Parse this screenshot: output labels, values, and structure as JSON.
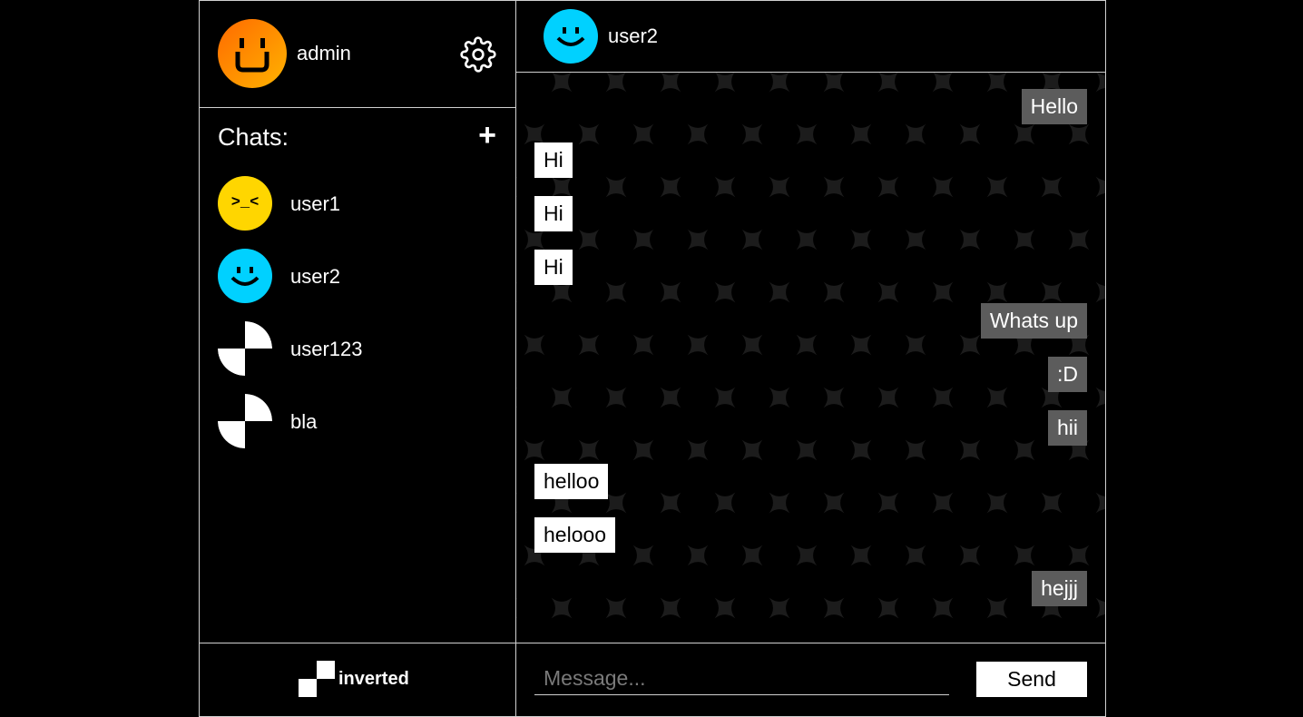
{
  "current_user": {
    "name": "admin",
    "avatar": "grin-face-icon"
  },
  "sidebar": {
    "chats_title": "Chats:",
    "add_label": "+",
    "chats": [
      {
        "name": "user1",
        "avatar": "squint-face-icon",
        "color": "#ffd600"
      },
      {
        "name": "user2",
        "avatar": "smile-face-icon",
        "color": "#00d1ff"
      },
      {
        "name": "user123",
        "avatar": "checker-avatar-icon",
        "color": "#ffffff"
      },
      {
        "name": "bla",
        "avatar": "checker-avatar-icon",
        "color": "#ffffff"
      }
    ],
    "brand": "inverted"
  },
  "chat": {
    "recipient": "user2",
    "messages": [
      {
        "text": "Hello",
        "direction": "out"
      },
      {
        "text": "Hi",
        "direction": "in"
      },
      {
        "text": "Hi",
        "direction": "in"
      },
      {
        "text": "Hi",
        "direction": "in"
      },
      {
        "text": "Whats up",
        "direction": "out"
      },
      {
        "text": ":D",
        "direction": "out"
      },
      {
        "text": "hii",
        "direction": "out"
      },
      {
        "text": "helloo",
        "direction": "in"
      },
      {
        "text": "helooo",
        "direction": "in"
      },
      {
        "text": "hejjj",
        "direction": "out"
      }
    ],
    "input_placeholder": "Message...",
    "send_label": "Send"
  },
  "colors": {
    "background": "#000000",
    "incoming_bubble": "#ffffff",
    "outgoing_bubble": "#5c5c5c",
    "admin_gradient": [
      "#ff6a00",
      "#ffb300"
    ],
    "frame": "#d0d0d0"
  }
}
